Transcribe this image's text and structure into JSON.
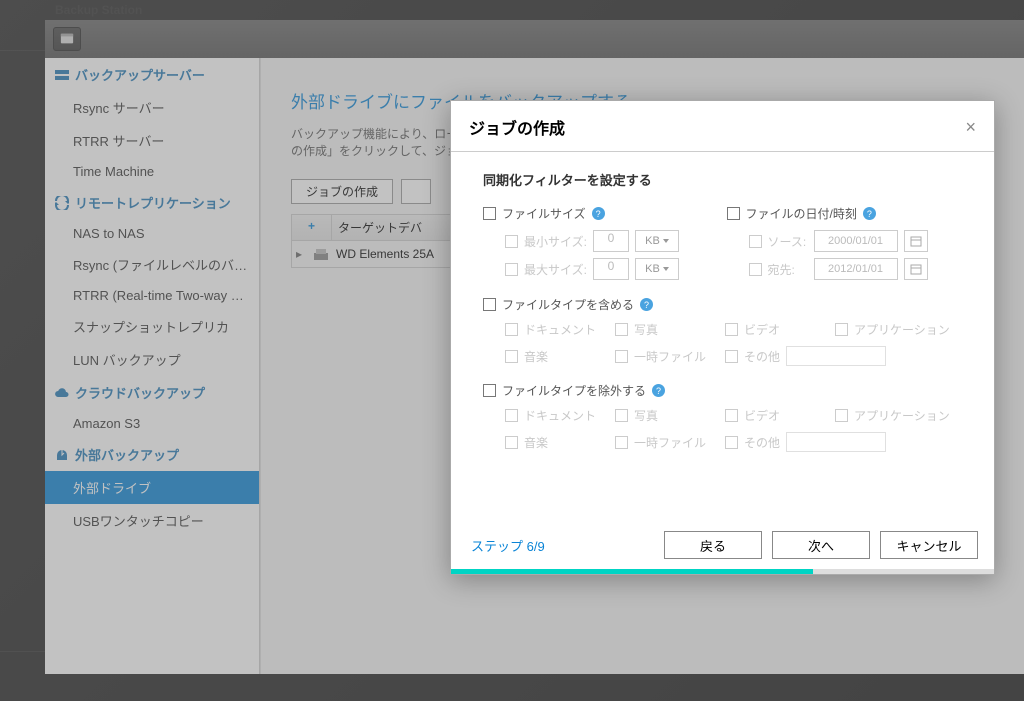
{
  "app_title": "Backup Station",
  "sidebar": {
    "groups": [
      {
        "icon": "server",
        "label": "バックアップサーバー",
        "items": [
          "Rsync サーバー",
          "RTRR サーバー",
          "Time Machine"
        ]
      },
      {
        "icon": "replication",
        "label": "リモートレプリケーション",
        "items": [
          "NAS to NAS",
          "Rsync (ファイルレベルのバック...",
          "RTRR (Real-time Two-way Folde...",
          "スナップショットレプリカ",
          "LUN バックアップ"
        ]
      },
      {
        "icon": "cloud",
        "label": "クラウドバックアップ",
        "items": [
          "Amazon S3"
        ]
      },
      {
        "icon": "external",
        "label": "外部バックアップ",
        "items": [
          "外部ドライブ",
          "USBワンタッチコピー"
        ],
        "active_index": 0
      }
    ]
  },
  "main": {
    "title": "外部ドライブにファイルをバックアップする",
    "description": "バックアップ機能により、ローカルディスクからローカルの外付けストレージデバイスにデータを複製できます。「ジョブの作成」をクリックして、ジョブが割り当てられた外部ストレージデバイスを選択します。",
    "create_job_btn": "ジョブの作成",
    "table": {
      "plus": "+",
      "header_target": "ターゲットデバ",
      "row_device": "WD Elements 25A"
    }
  },
  "dialog": {
    "title": "ジョブの作成",
    "subtitle": "同期化フィルターを設定する",
    "filesize": {
      "label": "ファイルサイズ",
      "min_label": "最小サイズ:",
      "min_value": "0",
      "min_unit": "KB",
      "max_label": "最大サイズ:",
      "max_value": "0",
      "max_unit": "KB"
    },
    "filedate": {
      "label": "ファイルの日付/時刻",
      "source_label": "ソース:",
      "source_value": "2000/01/01",
      "dest_label": "宛先:",
      "dest_value": "2012/01/01"
    },
    "include": {
      "label": "ファイルタイプを含める",
      "types": [
        "ドキュメント",
        "写真",
        "ビデオ",
        "アプリケーション",
        "音楽",
        "一時ファイル",
        "その他"
      ]
    },
    "exclude": {
      "label": "ファイルタイプを除外する",
      "types": [
        "ドキュメント",
        "写真",
        "ビデオ",
        "アプリケーション",
        "音楽",
        "一時ファイル",
        "その他"
      ]
    },
    "step": "ステップ 6/9",
    "back": "戻る",
    "next": "次へ",
    "cancel": "キャンセル"
  }
}
